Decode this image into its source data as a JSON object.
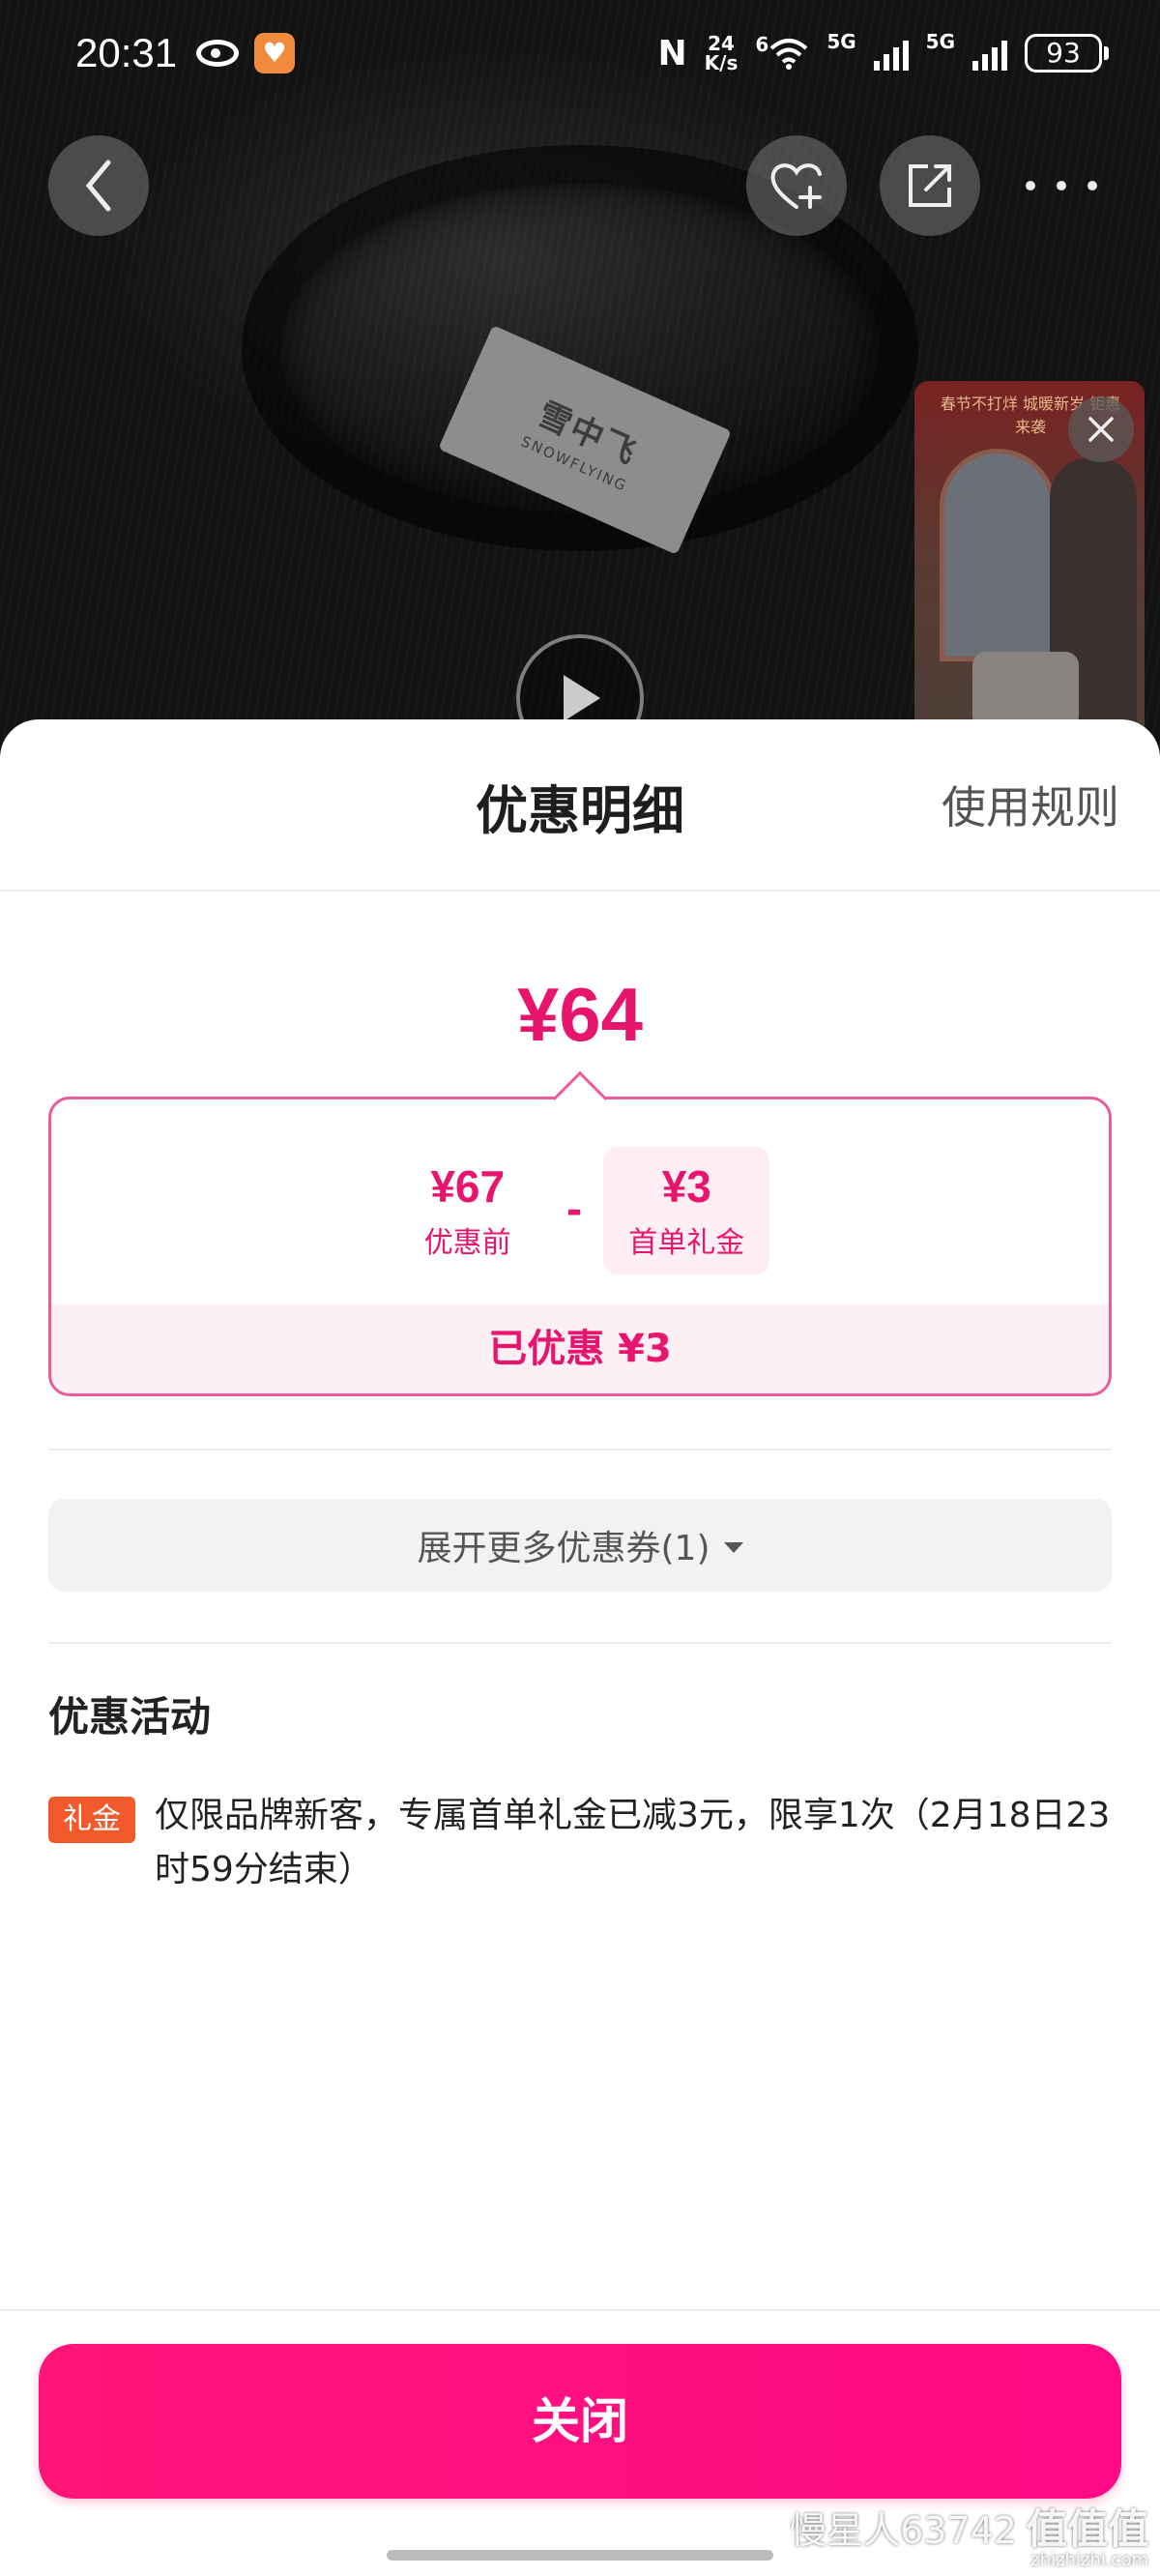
{
  "status_bar": {
    "time": "20:31",
    "network_speed_value": "24",
    "network_speed_unit": "K/s",
    "wifi_label": "6",
    "network_1": "5G",
    "network_2": "5G",
    "battery": "93"
  },
  "product": {
    "label_brand_cn": "雪中飞",
    "label_brand_en": "SNOWFLYING"
  },
  "promo_float": {
    "text": "春节不打烊 城暖新岁 钜惠来袭"
  },
  "sheet": {
    "title": "优惠明细",
    "rules_link": "使用规则",
    "final_price": "¥64",
    "original_price": "¥67",
    "original_caption": "优惠前",
    "minus": "-",
    "coupon_amount": "¥3",
    "coupon_caption": "首单礼金",
    "saved_text": "已优惠 ¥3",
    "expand_label": "展开更多优惠券(1)",
    "activities_title": "优惠活动",
    "activities": [
      {
        "tag": "礼金",
        "text": "仅限品牌新客，专属首单礼金已减3元，限享1次（2月18日23时59分结束）"
      }
    ],
    "close_label": "关闭"
  },
  "watermark": {
    "user": "慢星人63742",
    "site": "值值值",
    "domain": "zhizhizhi.com"
  },
  "colors": {
    "accent": "#e8156e",
    "button": "#ff1478",
    "tag": "#f25a2c"
  }
}
